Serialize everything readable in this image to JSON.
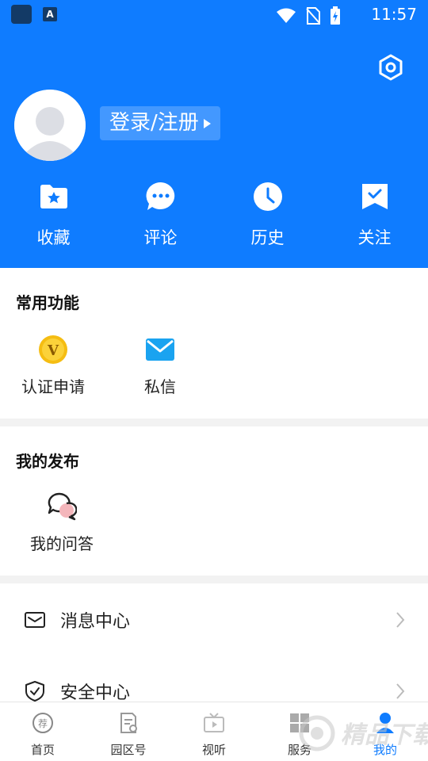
{
  "status_bar": {
    "time": "11:57",
    "app_badge": "A",
    "icons": [
      "app-icon",
      "text-app-icon",
      "wifi-icon",
      "no-sim-icon",
      "battery-charging-icon"
    ]
  },
  "header": {
    "login_label": "登录/注册",
    "quick_actions": [
      {
        "label": "收藏",
        "icon": "favorites-folder-icon"
      },
      {
        "label": "评论",
        "icon": "comment-bubble-icon"
      },
      {
        "label": "历史",
        "icon": "history-clock-icon"
      },
      {
        "label": "关注",
        "icon": "follow-bookmark-icon"
      }
    ],
    "background_color": "#0f7cff"
  },
  "common_functions": {
    "title": "常用功能",
    "items": [
      {
        "label": "认证申请",
        "icon": "verify-v-icon"
      },
      {
        "label": "私信",
        "icon": "mail-icon"
      }
    ]
  },
  "my_posts": {
    "title": "我的发布",
    "items": [
      {
        "label": "我的问答",
        "icon": "qa-bubbles-icon"
      }
    ]
  },
  "menu": {
    "items": [
      {
        "label": "消息中心",
        "icon": "message-envelope-icon"
      },
      {
        "label": "安全中心",
        "icon": "shield-check-icon"
      }
    ]
  },
  "tab_bar": {
    "tabs": [
      {
        "label": "首页",
        "icon": "home-recommend-icon",
        "active": false
      },
      {
        "label": "园区号",
        "icon": "park-account-icon",
        "active": false
      },
      {
        "label": "视听",
        "icon": "tv-play-icon",
        "active": false
      },
      {
        "label": "服务",
        "icon": "grid-services-icon",
        "active": false
      },
      {
        "label": "我的",
        "icon": "profile-icon",
        "active": true
      }
    ],
    "active_color": "#0f7cff"
  },
  "watermark": {
    "text": "精品下载"
  }
}
